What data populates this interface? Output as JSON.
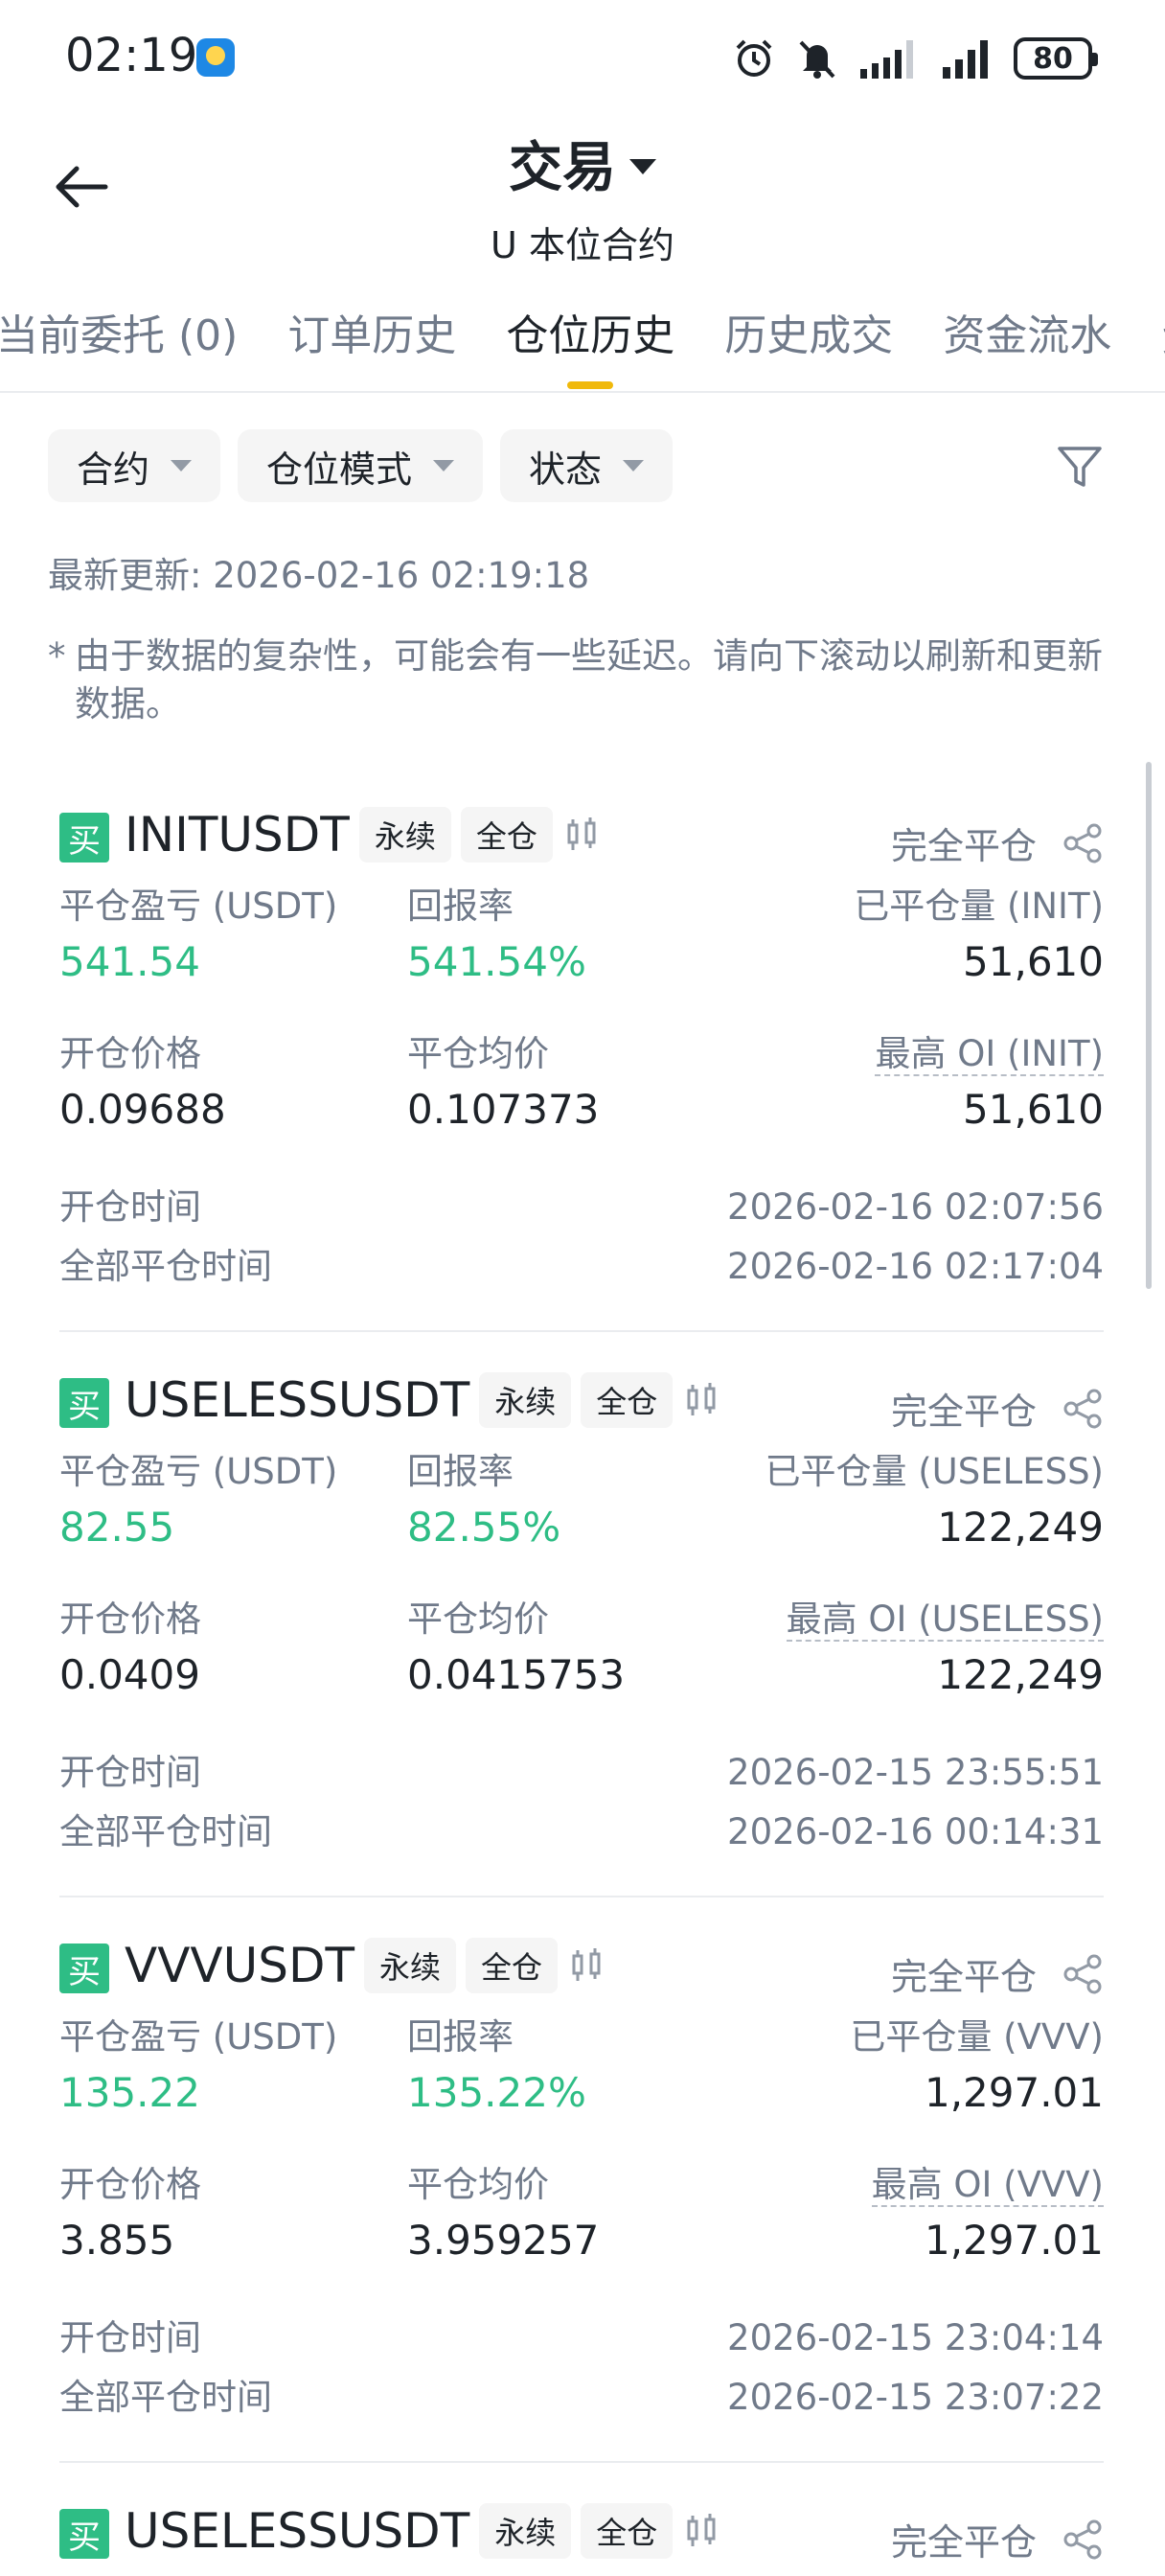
{
  "status_bar": {
    "time": "02:19",
    "battery": "80",
    "icons": [
      "weather-app-icon",
      "alarm-icon",
      "mute-icon",
      "signal-icon",
      "signal-icon",
      "battery-icon"
    ]
  },
  "header": {
    "title": "交易",
    "subtitle": "U 本位合约"
  },
  "tabs": [
    {
      "label": "当前委托 (0)"
    },
    {
      "label": "订单历史"
    },
    {
      "label": "仓位历史"
    },
    {
      "label": "历史成交"
    },
    {
      "label": "资金流水"
    },
    {
      "label": "资"
    }
  ],
  "filters": [
    {
      "label": "合约"
    },
    {
      "label": "仓位模式"
    },
    {
      "label": "状态"
    }
  ],
  "last_updated": "最新更新: 2026-02-16 02:19:18",
  "note": "由于数据的复杂性，可能会有一些延迟。请向下滚动以刷新和更新数据。",
  "note_star": "*",
  "colors": {
    "profit": "#2ebd85",
    "accent": "#f0b90b",
    "muted": "#707a8a"
  },
  "positions": [
    {
      "side": "买",
      "symbol": "INITUSDT",
      "tag_perp": "永续",
      "tag_cross": "全仓",
      "status": "完全平仓",
      "pnl_label": "平仓盈亏 (USDT)",
      "pnl": "541.54",
      "roi_label": "回报率",
      "roi": "541.54%",
      "closed_qty_label": "已平仓量 (INIT)",
      "closed_qty": "51,610",
      "open_price_label": "开仓价格",
      "open_price": "0.09688",
      "close_avg_label": "平仓均价",
      "close_avg": "0.107373",
      "max_oi_label": "最高 OI (INIT)",
      "max_oi": "51,610",
      "open_time_label": "开仓时间",
      "open_time": "2026-02-16 02:07:56",
      "close_time_label": "全部平仓时间",
      "close_time": "2026-02-16 02:17:04"
    },
    {
      "side": "买",
      "symbol": "USELESSUSDT",
      "tag_perp": "永续",
      "tag_cross": "全仓",
      "status": "完全平仓",
      "pnl_label": "平仓盈亏 (USDT)",
      "pnl": "82.55",
      "roi_label": "回报率",
      "roi": "82.55%",
      "closed_qty_label": "已平仓量 (USELESS)",
      "closed_qty": "122,249",
      "open_price_label": "开仓价格",
      "open_price": "0.0409",
      "close_avg_label": "平仓均价",
      "close_avg": "0.0415753",
      "max_oi_label": "最高 OI (USELESS)",
      "max_oi": "122,249",
      "open_time_label": "开仓时间",
      "open_time": "2026-02-15 23:55:51",
      "close_time_label": "全部平仓时间",
      "close_time": "2026-02-16 00:14:31"
    },
    {
      "side": "买",
      "symbol": "VVVUSDT",
      "tag_perp": "永续",
      "tag_cross": "全仓",
      "status": "完全平仓",
      "pnl_label": "平仓盈亏 (USDT)",
      "pnl": "135.22",
      "roi_label": "回报率",
      "roi": "135.22%",
      "closed_qty_label": "已平仓量 (VVV)",
      "closed_qty": "1,297.01",
      "open_price_label": "开仓价格",
      "open_price": "3.855",
      "close_avg_label": "平仓均价",
      "close_avg": "3.959257",
      "max_oi_label": "最高 OI (VVV)",
      "max_oi": "1,297.01",
      "open_time_label": "开仓时间",
      "open_time": "2026-02-15 23:04:14",
      "close_time_label": "全部平仓时间",
      "close_time": "2026-02-15 23:07:22"
    },
    {
      "side": "买",
      "symbol": "USELESSUSDT",
      "tag_perp": "永续",
      "tag_cross": "全仓",
      "status": "完全平仓"
    }
  ]
}
